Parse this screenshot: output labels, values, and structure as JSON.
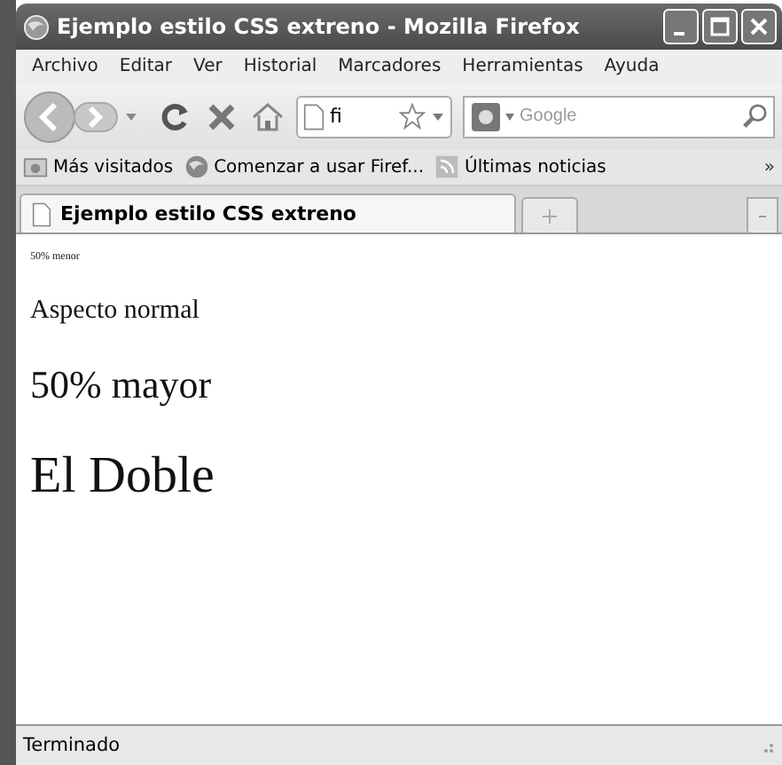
{
  "window": {
    "title": "Ejemplo estilo CSS extreno - Mozilla Firefox"
  },
  "menu": [
    "Archivo",
    "Editar",
    "Ver",
    "Historial",
    "Marcadores",
    "Herramientas",
    "Ayuda"
  ],
  "toolbar": {
    "address_value": "fi",
    "search_placeholder": "Google"
  },
  "bookmarks": [
    {
      "label": "Más visitados",
      "kind": "folder"
    },
    {
      "label": "Comenzar a usar Firef...",
      "kind": "globe"
    },
    {
      "label": "Últimas noticias",
      "kind": "feed"
    }
  ],
  "bookmarks_overflow": "»",
  "tabs": [
    {
      "label": "Ejemplo estilo CSS extreno",
      "selected": true
    }
  ],
  "page": [
    {
      "text": "50% menor",
      "kind": "small"
    },
    {
      "text": "Aspecto normal",
      "kind": "normal"
    },
    {
      "text": "50% mayor",
      "kind": "larger"
    },
    {
      "text": "El Doble",
      "kind": "double"
    }
  ],
  "status_bar": "Terminado"
}
